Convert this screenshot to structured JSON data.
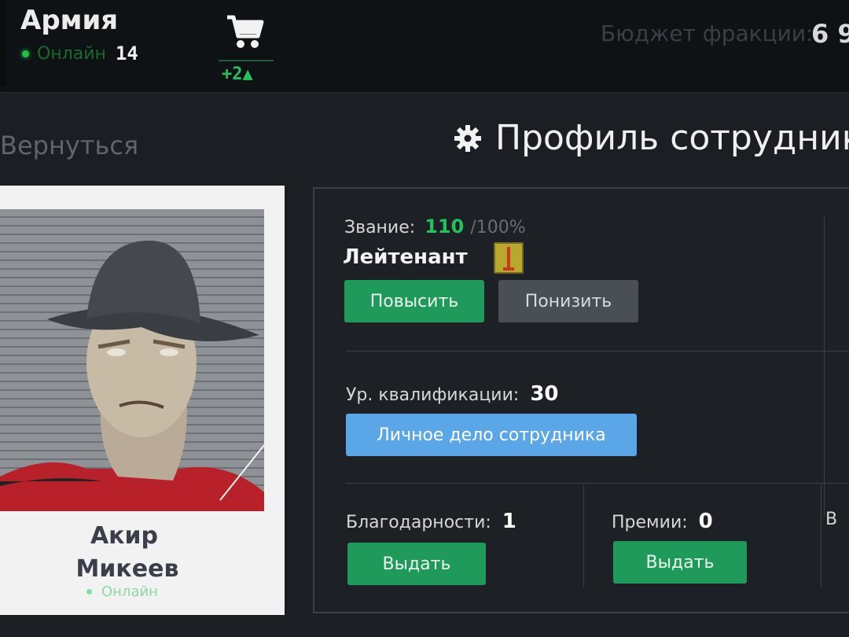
{
  "header": {
    "faction_name": "Армия",
    "online_label": "Онлайн",
    "online_count": "14",
    "cart_badge": "+2▲",
    "budget_label": "Бюджет фракции:",
    "budget_value": "6 9"
  },
  "nav": {
    "back_label": "Вернуться",
    "page_title": "Профиль сотрудника"
  },
  "profile_card": {
    "first_name": "Акир",
    "last_name": "Микеев",
    "status": "Онлайн"
  },
  "rank": {
    "label": "Звание:",
    "progress_value": "110",
    "progress_max": "/100%",
    "name": "Лейтенант",
    "promote_button": "Повысить",
    "demote_button": "Понизить"
  },
  "qualification": {
    "label": "Ур. квалификации:",
    "value": "30",
    "dossier_button": "Личное дело сотрудника"
  },
  "gratitude": {
    "label": "Благодарности:",
    "value": "1",
    "issue_button": "Выдать"
  },
  "premiums": {
    "label": "Премии:",
    "value": "0",
    "issue_button": "Выдать"
  },
  "extra": {
    "label": "В"
  },
  "colors": {
    "accent_green": "#1f9a5a",
    "online_green": "#1fbf4a",
    "dossier_blue": "#5aa6e6",
    "demote_gray": "#4a4f55"
  }
}
